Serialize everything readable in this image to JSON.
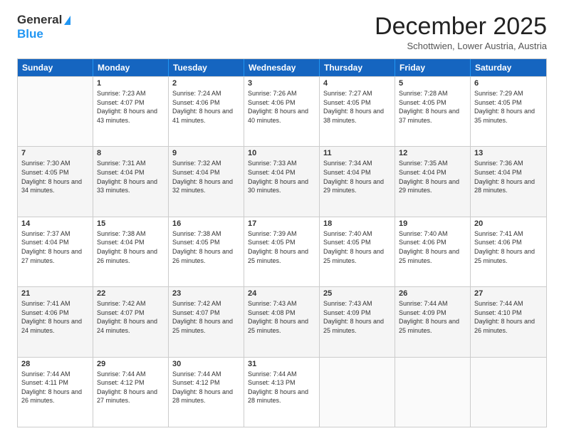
{
  "logo": {
    "general": "General",
    "blue": "Blue"
  },
  "title": "December 2025",
  "location": "Schottwien, Lower Austria, Austria",
  "days_of_week": [
    "Sunday",
    "Monday",
    "Tuesday",
    "Wednesday",
    "Thursday",
    "Friday",
    "Saturday"
  ],
  "weeks": [
    [
      {
        "day": "",
        "sunrise": "",
        "sunset": "",
        "daylight": ""
      },
      {
        "day": "1",
        "sunrise": "Sunrise: 7:23 AM",
        "sunset": "Sunset: 4:07 PM",
        "daylight": "Daylight: 8 hours and 43 minutes."
      },
      {
        "day": "2",
        "sunrise": "Sunrise: 7:24 AM",
        "sunset": "Sunset: 4:06 PM",
        "daylight": "Daylight: 8 hours and 41 minutes."
      },
      {
        "day": "3",
        "sunrise": "Sunrise: 7:26 AM",
        "sunset": "Sunset: 4:06 PM",
        "daylight": "Daylight: 8 hours and 40 minutes."
      },
      {
        "day": "4",
        "sunrise": "Sunrise: 7:27 AM",
        "sunset": "Sunset: 4:05 PM",
        "daylight": "Daylight: 8 hours and 38 minutes."
      },
      {
        "day": "5",
        "sunrise": "Sunrise: 7:28 AM",
        "sunset": "Sunset: 4:05 PM",
        "daylight": "Daylight: 8 hours and 37 minutes."
      },
      {
        "day": "6",
        "sunrise": "Sunrise: 7:29 AM",
        "sunset": "Sunset: 4:05 PM",
        "daylight": "Daylight: 8 hours and 35 minutes."
      }
    ],
    [
      {
        "day": "7",
        "sunrise": "Sunrise: 7:30 AM",
        "sunset": "Sunset: 4:05 PM",
        "daylight": "Daylight: 8 hours and 34 minutes."
      },
      {
        "day": "8",
        "sunrise": "Sunrise: 7:31 AM",
        "sunset": "Sunset: 4:04 PM",
        "daylight": "Daylight: 8 hours and 33 minutes."
      },
      {
        "day": "9",
        "sunrise": "Sunrise: 7:32 AM",
        "sunset": "Sunset: 4:04 PM",
        "daylight": "Daylight: 8 hours and 32 minutes."
      },
      {
        "day": "10",
        "sunrise": "Sunrise: 7:33 AM",
        "sunset": "Sunset: 4:04 PM",
        "daylight": "Daylight: 8 hours and 30 minutes."
      },
      {
        "day": "11",
        "sunrise": "Sunrise: 7:34 AM",
        "sunset": "Sunset: 4:04 PM",
        "daylight": "Daylight: 8 hours and 29 minutes."
      },
      {
        "day": "12",
        "sunrise": "Sunrise: 7:35 AM",
        "sunset": "Sunset: 4:04 PM",
        "daylight": "Daylight: 8 hours and 29 minutes."
      },
      {
        "day": "13",
        "sunrise": "Sunrise: 7:36 AM",
        "sunset": "Sunset: 4:04 PM",
        "daylight": "Daylight: 8 hours and 28 minutes."
      }
    ],
    [
      {
        "day": "14",
        "sunrise": "Sunrise: 7:37 AM",
        "sunset": "Sunset: 4:04 PM",
        "daylight": "Daylight: 8 hours and 27 minutes."
      },
      {
        "day": "15",
        "sunrise": "Sunrise: 7:38 AM",
        "sunset": "Sunset: 4:04 PM",
        "daylight": "Daylight: 8 hours and 26 minutes."
      },
      {
        "day": "16",
        "sunrise": "Sunrise: 7:38 AM",
        "sunset": "Sunset: 4:05 PM",
        "daylight": "Daylight: 8 hours and 26 minutes."
      },
      {
        "day": "17",
        "sunrise": "Sunrise: 7:39 AM",
        "sunset": "Sunset: 4:05 PM",
        "daylight": "Daylight: 8 hours and 25 minutes."
      },
      {
        "day": "18",
        "sunrise": "Sunrise: 7:40 AM",
        "sunset": "Sunset: 4:05 PM",
        "daylight": "Daylight: 8 hours and 25 minutes."
      },
      {
        "day": "19",
        "sunrise": "Sunrise: 7:40 AM",
        "sunset": "Sunset: 4:06 PM",
        "daylight": "Daylight: 8 hours and 25 minutes."
      },
      {
        "day": "20",
        "sunrise": "Sunrise: 7:41 AM",
        "sunset": "Sunset: 4:06 PM",
        "daylight": "Daylight: 8 hours and 25 minutes."
      }
    ],
    [
      {
        "day": "21",
        "sunrise": "Sunrise: 7:41 AM",
        "sunset": "Sunset: 4:06 PM",
        "daylight": "Daylight: 8 hours and 24 minutes."
      },
      {
        "day": "22",
        "sunrise": "Sunrise: 7:42 AM",
        "sunset": "Sunset: 4:07 PM",
        "daylight": "Daylight: 8 hours and 24 minutes."
      },
      {
        "day": "23",
        "sunrise": "Sunrise: 7:42 AM",
        "sunset": "Sunset: 4:07 PM",
        "daylight": "Daylight: 8 hours and 25 minutes."
      },
      {
        "day": "24",
        "sunrise": "Sunrise: 7:43 AM",
        "sunset": "Sunset: 4:08 PM",
        "daylight": "Daylight: 8 hours and 25 minutes."
      },
      {
        "day": "25",
        "sunrise": "Sunrise: 7:43 AM",
        "sunset": "Sunset: 4:09 PM",
        "daylight": "Daylight: 8 hours and 25 minutes."
      },
      {
        "day": "26",
        "sunrise": "Sunrise: 7:44 AM",
        "sunset": "Sunset: 4:09 PM",
        "daylight": "Daylight: 8 hours and 25 minutes."
      },
      {
        "day": "27",
        "sunrise": "Sunrise: 7:44 AM",
        "sunset": "Sunset: 4:10 PM",
        "daylight": "Daylight: 8 hours and 26 minutes."
      }
    ],
    [
      {
        "day": "28",
        "sunrise": "Sunrise: 7:44 AM",
        "sunset": "Sunset: 4:11 PM",
        "daylight": "Daylight: 8 hours and 26 minutes."
      },
      {
        "day": "29",
        "sunrise": "Sunrise: 7:44 AM",
        "sunset": "Sunset: 4:12 PM",
        "daylight": "Daylight: 8 hours and 27 minutes."
      },
      {
        "day": "30",
        "sunrise": "Sunrise: 7:44 AM",
        "sunset": "Sunset: 4:12 PM",
        "daylight": "Daylight: 8 hours and 28 minutes."
      },
      {
        "day": "31",
        "sunrise": "Sunrise: 7:44 AM",
        "sunset": "Sunset: 4:13 PM",
        "daylight": "Daylight: 8 hours and 28 minutes."
      },
      {
        "day": "",
        "sunrise": "",
        "sunset": "",
        "daylight": ""
      },
      {
        "day": "",
        "sunrise": "",
        "sunset": "",
        "daylight": ""
      },
      {
        "day": "",
        "sunrise": "",
        "sunset": "",
        "daylight": ""
      }
    ]
  ]
}
